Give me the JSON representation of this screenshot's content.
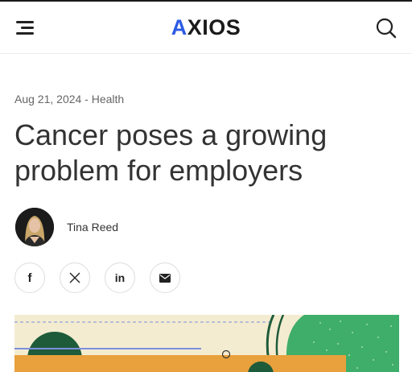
{
  "header": {
    "logo": {
      "pre": "",
      "accent": "A",
      "rest": "XIOS"
    },
    "menu_icon": "hamburger-icon",
    "search_icon": "search-icon"
  },
  "article": {
    "date": "Aug 21, 2024",
    "separator": " - ",
    "category": "Health",
    "headline": "Cancer poses a growing problem for employers",
    "author": "Tina Reed"
  },
  "share": {
    "facebook": "f",
    "x": "𝕏",
    "linkedin": "in",
    "email_icon": "envelope-icon"
  },
  "colors": {
    "logo_accent": "#2d5be3",
    "hero_bg": "#f4ecd0",
    "hero_green": "#3fae6a",
    "hero_dark_green": "#1e5b3a",
    "hero_orange": "#e8a13c"
  }
}
